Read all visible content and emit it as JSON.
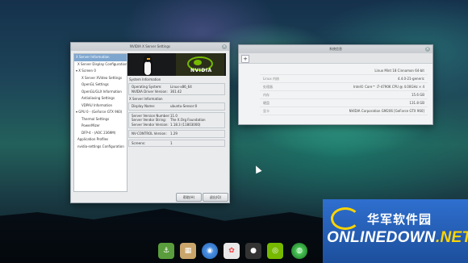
{
  "nvidia_window": {
    "title": "NVIDIA X Server Settings",
    "sidebar": [
      {
        "label": "X Server Information",
        "selected": true
      },
      {
        "label": "X Server Display Configuration"
      },
      {
        "label": "▾ X Screen 0"
      },
      {
        "label": "X Server XVideo Settings"
      },
      {
        "label": "OpenGL Settings"
      },
      {
        "label": "OpenGL/GLX Information"
      },
      {
        "label": "Antialiasing Settings"
      },
      {
        "label": "VDPAU Information"
      },
      {
        "label": "▾ GPU 0 - (GeForce GTX 960)"
      },
      {
        "label": "Thermal Settings"
      },
      {
        "label": "PowerMizer"
      },
      {
        "label": "DFP-4 - (AOC 2369M)"
      },
      {
        "label": "Application Profiles"
      },
      {
        "label": "nvidia-settings Configuration"
      }
    ],
    "banner_logo_text": "NVIDIA",
    "system_info": {
      "header": "System Information",
      "rows": [
        {
          "k": "Operating System:",
          "v": "Linux-x86_64"
        },
        {
          "k": "NVIDIA Driver Version:",
          "v": "361.42"
        }
      ]
    },
    "xserver_info": {
      "header": "X Server Information",
      "rows": [
        {
          "k": "Display Name:",
          "v": "ubuntu-Sensor:0"
        },
        {
          "k": "Server Version Number:",
          "v": "11.0"
        },
        {
          "k": "Server Vendor String:",
          "v": "The X.Org Foundation"
        },
        {
          "k": "Server Vendor Version:",
          "v": "1.18.3 (11803000)"
        },
        {
          "k": "NV-CONTROL Version:",
          "v": "1.29"
        },
        {
          "k": "Screens:",
          "v": "1"
        }
      ]
    },
    "buttons": {
      "help": "帮助(H)",
      "quit": "退出(Q)"
    }
  },
  "sysinfo_window": {
    "title": "系统信息",
    "add_label": "+",
    "rows": [
      {
        "k": "",
        "v": "Linux Mint 18 Cinnamon 64-bit"
      },
      {
        "k": "Linux 内核",
        "v": "4.4.0-21-generic"
      },
      {
        "k": "处理器",
        "v": "Intel© Core™ i7-4790K CPU @ 4.00GHz × 4"
      },
      {
        "k": "内存",
        "v": "15.6 GB"
      },
      {
        "k": "硬盘",
        "v": "131.8 GB"
      },
      {
        "k": "显卡",
        "v": "NVIDIA Corporation GM206 [GeForce GTX 960]"
      }
    ]
  },
  "dock": {
    "items": [
      "anchor-app-icon",
      "file-manager-icon",
      "chrome-icon",
      "photos-icon",
      "camera-icon",
      "nvidia-icon",
      "globe-icon"
    ]
  },
  "watermark": {
    "chinese": "华军软件园",
    "english_prefix": "ONLINEDOWN",
    "english_suffix": ".NET"
  }
}
